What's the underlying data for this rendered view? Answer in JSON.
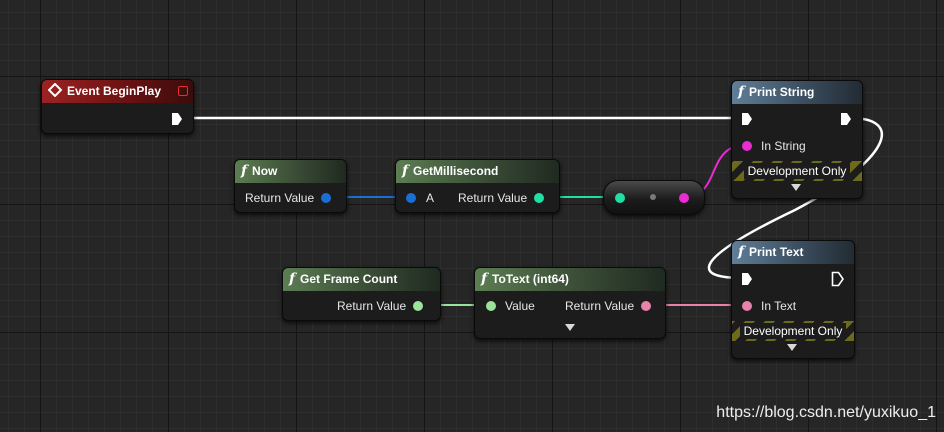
{
  "colors": {
    "exec": "#ffffff",
    "int64": "#1a6fd6",
    "int": "#1fe0a4",
    "string": "#ea2cd3",
    "text": "#e882aa",
    "integer_pin": "#9be39b",
    "event_header": "#7a1515",
    "function_header": "#4d6845",
    "print_header": "#54707f"
  },
  "nodes": {
    "begin_play": {
      "title": "Event BeginPlay",
      "icon": "event-diamond-icon"
    },
    "now": {
      "title": "Now",
      "output": "Return Value"
    },
    "get_millisecond": {
      "title": "GetMillisecond",
      "input": "A",
      "output": "Return Value"
    },
    "convert": {
      "icon": "conversion-dot-icon"
    },
    "print_string": {
      "title": "Print String",
      "input": "In String",
      "dev": "Development Only"
    },
    "get_frame_count": {
      "title": "Get Frame Count",
      "output": "Return Value"
    },
    "to_text": {
      "title": "ToText (int64)",
      "input": "Value",
      "output": "Return Value"
    },
    "print_text": {
      "title": "Print Text",
      "input": "In Text",
      "dev": "Development Only"
    }
  },
  "watermark": "https://blog.csdn.net/yuxikuo_1"
}
